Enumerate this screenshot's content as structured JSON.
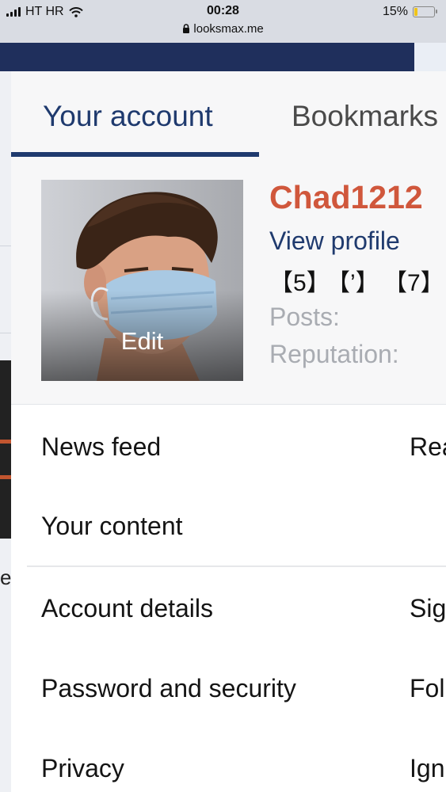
{
  "status_bar": {
    "carrier": "HT HR",
    "time": "00:28",
    "url": "looksmax.me",
    "battery": "15%",
    "battery_level": 0.15
  },
  "background": {
    "partial_letter": "e"
  },
  "tabs": [
    {
      "label": "Your account",
      "active": true
    },
    {
      "label": "Bookmarks",
      "active": false
    }
  ],
  "profile": {
    "username": "Chad1212",
    "view_profile": "View profile",
    "avatar_edit": "Edit",
    "tags": [
      "【5】",
      "【’】",
      "【7】"
    ],
    "posts_label": "Posts:",
    "reputation_label": "Reputation:"
  },
  "menu": {
    "left": [
      "News feed",
      "Your content",
      "Account details",
      "Password and security",
      "Privacy"
    ],
    "right": [
      "Rea",
      "Sig",
      "Fol",
      "Ign"
    ]
  },
  "colors": {
    "accent": "#1f3a6e",
    "username": "#d0573c",
    "header": "#1f2f5c",
    "muted": "#a9acb2"
  }
}
